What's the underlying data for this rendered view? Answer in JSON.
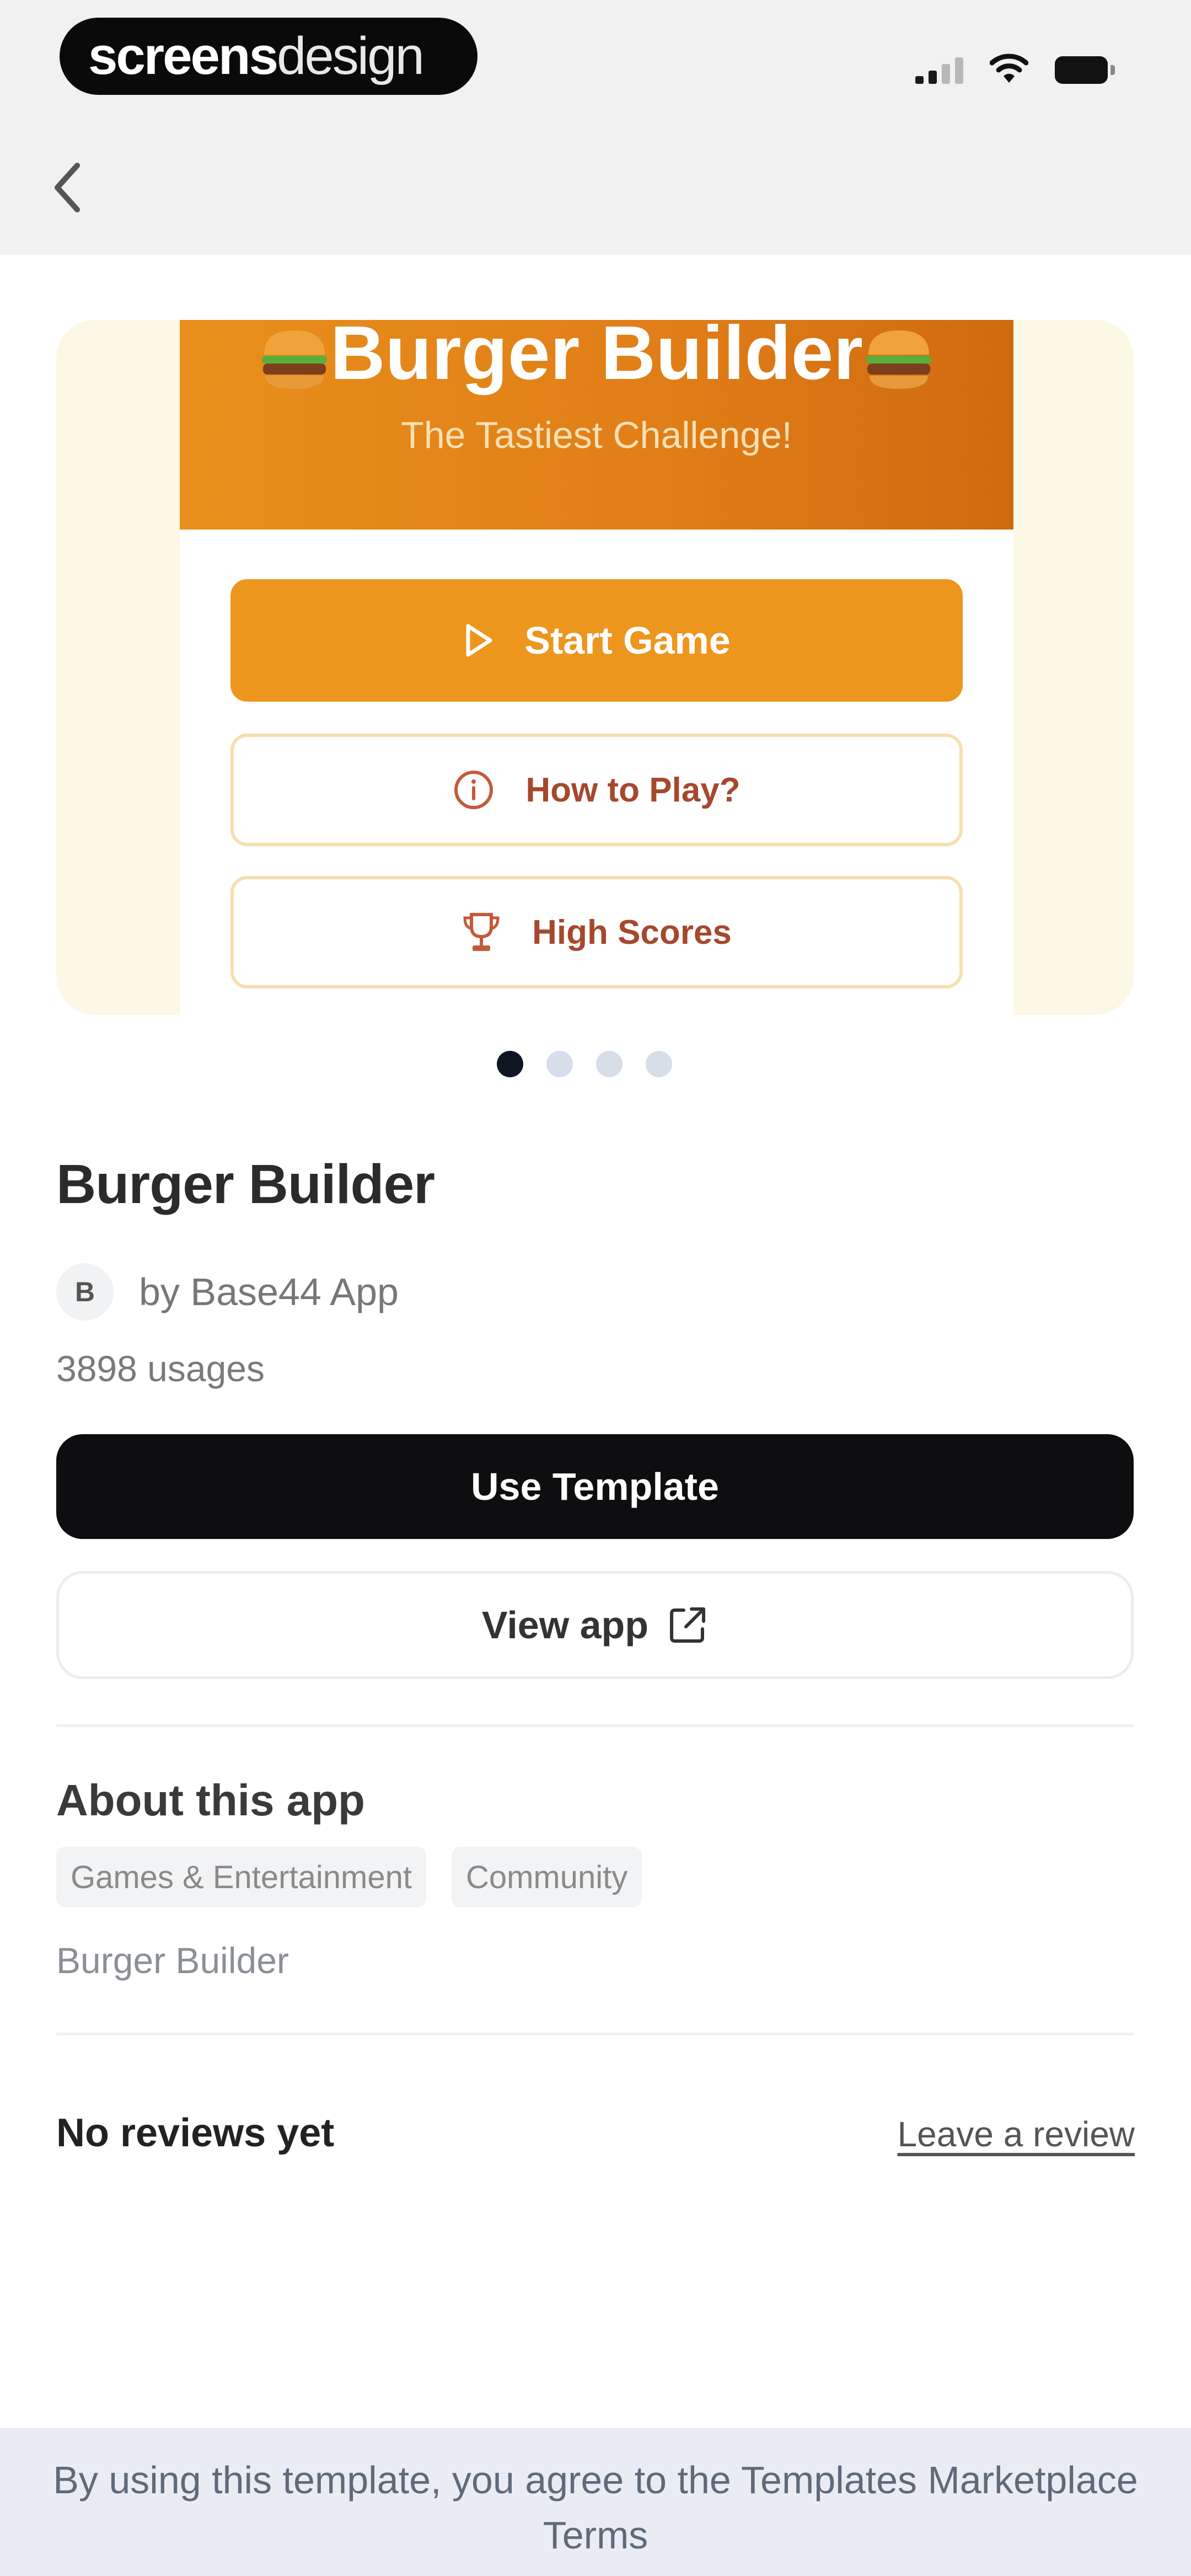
{
  "status_bar": {
    "brand_bold": "screens",
    "brand_light": "design",
    "signal_icon": "cellular-signal-icon",
    "wifi_icon": "wifi-icon",
    "battery_icon": "battery-icon"
  },
  "nav": {
    "back_icon": "chevron-left-icon"
  },
  "preview": {
    "title": "Burger Builder",
    "subtitle": "The Tastiest Challenge!",
    "buttons": [
      {
        "label": "Start Game",
        "icon": "play-icon"
      },
      {
        "label": "How to Play?",
        "icon": "info-circle-icon"
      },
      {
        "label": "High Scores",
        "icon": "trophy-icon"
      }
    ],
    "page_count": 4,
    "current_page": 1
  },
  "app": {
    "title": "Burger Builder",
    "author_initial": "B",
    "author": "by Base44 App",
    "usages": "3898 usages"
  },
  "actions": {
    "use_template": "Use Template",
    "view_app": "View app"
  },
  "about": {
    "title": "About this app",
    "tags": [
      "Games & Entertainment",
      "Community"
    ],
    "description": "Burger Builder"
  },
  "reviews": {
    "empty": "No reviews yet",
    "leave": "Leave a review"
  },
  "footer": {
    "text": "By using this template, you agree to the Templates Marketplace Terms"
  },
  "colors": {
    "accent_orange": "#ed961d",
    "outline_text": "#a5482d",
    "primary_button": "#0e0e10",
    "card_background": "#fcf8e6",
    "footer_background": "#e9edf3"
  }
}
